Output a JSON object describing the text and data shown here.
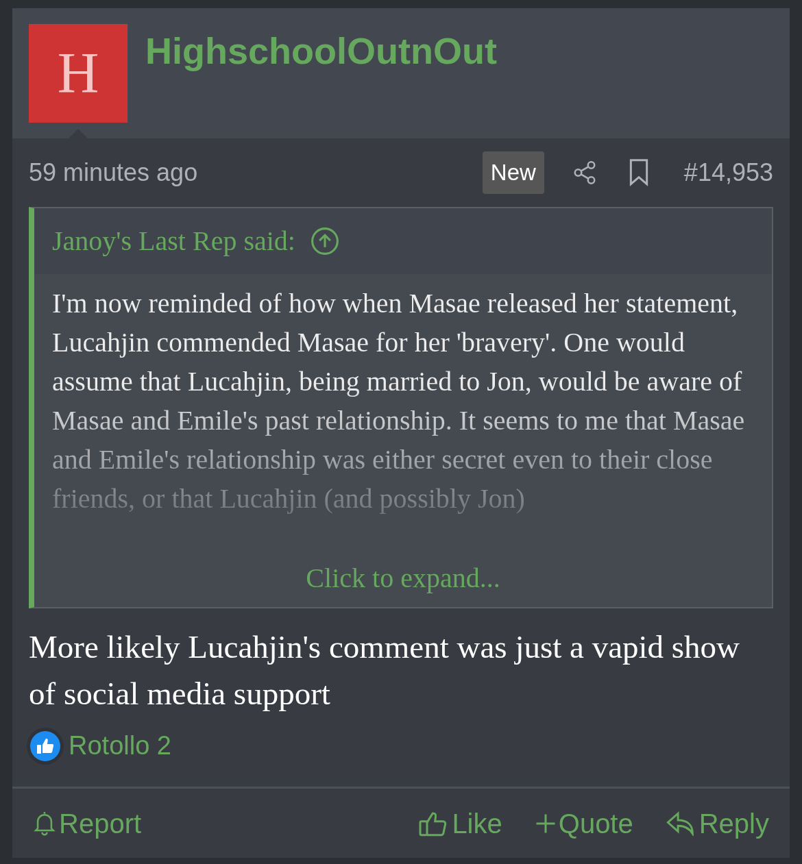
{
  "post": {
    "avatar_letter": "H",
    "username": "HighschoolOutnOut",
    "time": "59 minutes ago",
    "badge": "New",
    "post_number": "#14,953"
  },
  "quote": {
    "author": "Janoy's Last Rep said:",
    "text": "I'm now reminded of how when Masae released her statement, Lucahjin commended Masae for her 'bravery'. One would assume that Lucahjin, being married to Jon, would be aware of Masae and Emile's past relationship. It seems to me that Masae and Emile's relationship was either secret even to their close friends, or that Lucahjin (and possibly Jon)",
    "expand": "Click to expand..."
  },
  "message": "More likely Lucahjin's comment was just a vapid show of social media support",
  "reactions": {
    "text": "Rotollo 2"
  },
  "actions": [
    {
      "kind": "report",
      "label": "Report"
    },
    {
      "kind": "like",
      "label": "Like"
    },
    {
      "kind": "quote",
      "label": "Quote"
    },
    {
      "kind": "reply",
      "label": "Reply"
    }
  ]
}
